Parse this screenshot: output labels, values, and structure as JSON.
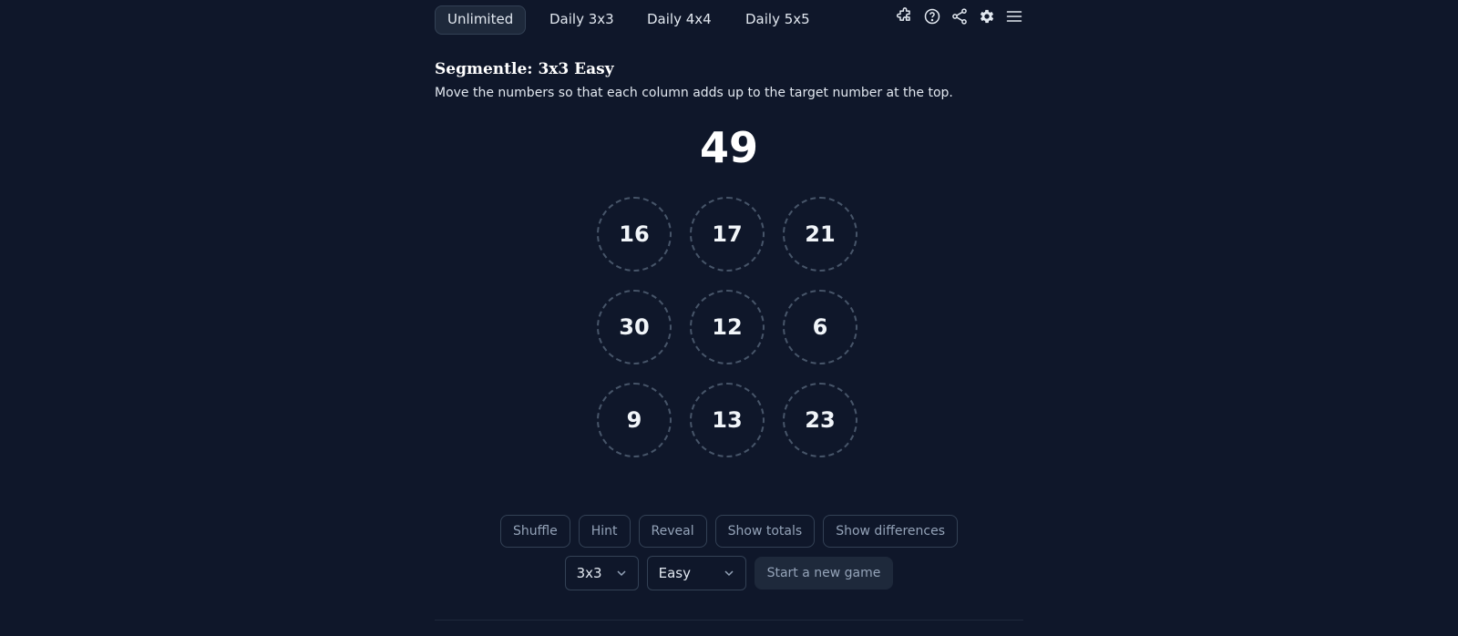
{
  "nav": {
    "tabs": [
      {
        "label": "Unlimited",
        "active": true
      },
      {
        "label": "Daily 3x3",
        "active": false
      },
      {
        "label": "Daily 4x4",
        "active": false
      },
      {
        "label": "Daily 5x5",
        "active": false
      }
    ],
    "icons": [
      "puzzle-icon",
      "help-icon",
      "share-icon",
      "gear-icon",
      "menu-icon"
    ]
  },
  "game": {
    "title": "Segmentle: 3x3 Easy",
    "instructions": "Move the numbers so that each column adds up to the target number at the top.",
    "target": "49",
    "grid": [
      [
        "16",
        "17",
        "21"
      ],
      [
        "30",
        "12",
        "6"
      ],
      [
        "9",
        "13",
        "23"
      ]
    ]
  },
  "controls": {
    "shuffle": "Shuffle",
    "hint": "Hint",
    "reveal": "Reveal",
    "show_totals": "Show totals",
    "show_differences": "Show differences",
    "size_select": "3x3",
    "difficulty_select": "Easy",
    "new_game": "Start a new game"
  },
  "colors": {
    "background": "#0f172a",
    "surface": "#1e293b",
    "border": "#334155",
    "dashed": "#475569",
    "muted_text": "#94a3b8"
  }
}
